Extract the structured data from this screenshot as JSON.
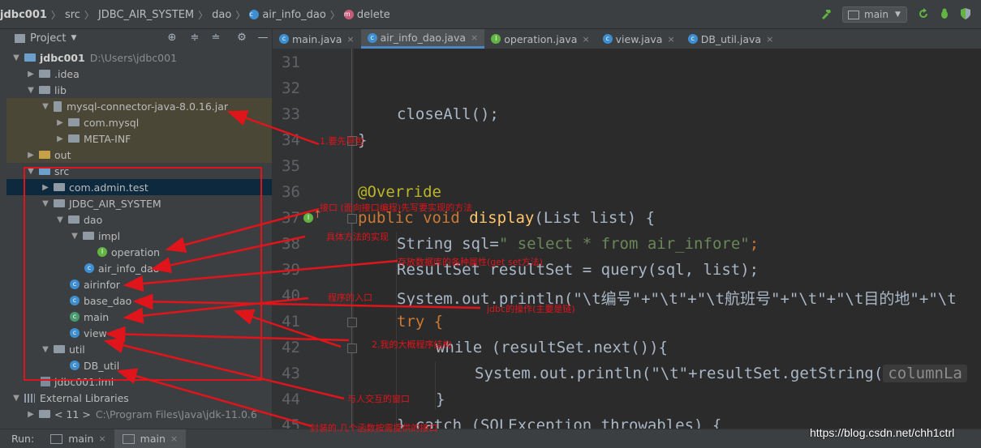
{
  "breadcrumb": [
    "jdbc001",
    "src",
    "JDBC_AIR_SYSTEM",
    "dao",
    "air_info_dao",
    "delete"
  ],
  "run_config": "main",
  "project_panel": {
    "title": "Project",
    "tree": [
      {
        "label": "jdbc001",
        "path": "D:\\Users\\jdbc001"
      },
      {
        "label": ".idea"
      },
      {
        "label": "lib"
      },
      {
        "label": "mysql-connector-java-8.0.16.jar"
      },
      {
        "label": "com.mysql"
      },
      {
        "label": "META-INF"
      },
      {
        "label": "out"
      },
      {
        "label": "src"
      },
      {
        "label": "com.admin.test"
      },
      {
        "label": "JDBC_AIR_SYSTEM"
      },
      {
        "label": "dao"
      },
      {
        "label": "impl"
      },
      {
        "label": "operation"
      },
      {
        "label": "air_info_dao"
      },
      {
        "label": "airinfor"
      },
      {
        "label": "base_dao"
      },
      {
        "label": "main"
      },
      {
        "label": "view"
      },
      {
        "label": "util"
      },
      {
        "label": "DB_util"
      },
      {
        "label": "jdbc001.iml"
      },
      {
        "label": "External Libraries"
      },
      {
        "label": "< 11 >",
        "path": "C:\\Program Files\\Java\\jdk-11.0.6"
      }
    ]
  },
  "tabs": [
    {
      "label": "main.java"
    },
    {
      "label": "air_info_dao.java"
    },
    {
      "label": "operation.java"
    },
    {
      "label": "view.java"
    },
    {
      "label": "DB_util.java"
    }
  ],
  "editor": {
    "line_numbers": [
      "31",
      "32",
      "33",
      "34",
      "35",
      "36",
      "37",
      "38",
      "39",
      "40",
      "41",
      "42",
      "43",
      "44",
      "45"
    ],
    "code": {
      "l33": "closeAll();",
      "l34": "}",
      "l36": "@Override",
      "l37_kw": "public void",
      "l37_fn": "display",
      "l37_rest": "(List list) {",
      "l38_a": "String sql=",
      "l38_str": "\" select * from air_infore\"",
      "l38_b": ";",
      "l39": "ResultSet resultSet = query(sql, list);",
      "l40": "System.out.println(\"\\t编号\"+\"\\t\"+\"\\t航班号\"+\"\\t\"+\"\\t目的地\"+\"\\t",
      "l41": "try {",
      "l42": "while (resultSet.next()){",
      "l43": "System.out.println(\"\\t\"+resultSet.getString(",
      "l43_hint": "columnLa",
      "l44": "}",
      "l45": "} catch (SQLException throwables) {"
    }
  },
  "run_bar": {
    "label": "Run:",
    "tabs": [
      "main",
      "main"
    ]
  },
  "watermark": "https://blog.csdn.net/chh1ctrl",
  "annotations": [
    "1.要先导包",
    "接口 (面向接口编程)先写要实现的方法",
    "具体方法的实现",
    "存放数据库的各种属性(get set方法)",
    "程序的入口",
    "jdbc的操作(主要是链)",
    "2.我的大概程序结构",
    "与人交互的窗口",
    "封装的.几个函数按需提供的接口"
  ]
}
